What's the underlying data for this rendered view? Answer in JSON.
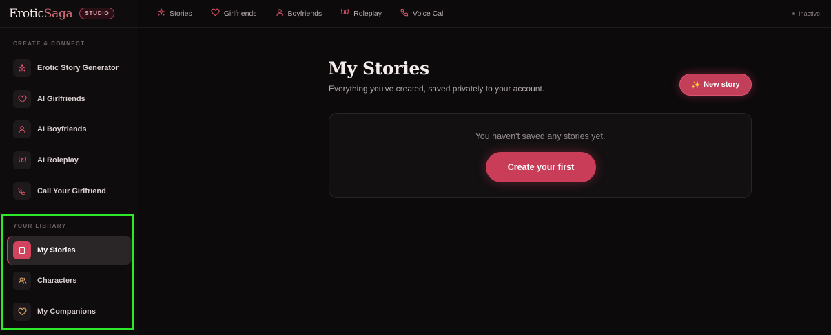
{
  "brand": {
    "name_part1": "Erotic",
    "name_part2": "Saga",
    "badge": "STUDIO"
  },
  "sidebar": {
    "create_section_label": "CREATE & CONNECT",
    "create_items": [
      {
        "label": "Erotic Story Generator",
        "icon": "sparkles-icon"
      },
      {
        "label": "AI Girlfriends",
        "icon": "heart-icon"
      },
      {
        "label": "AI Boyfriends",
        "icon": "user-icon"
      },
      {
        "label": "AI Roleplay",
        "icon": "masks-icon"
      },
      {
        "label": "Call Your Girlfriend",
        "icon": "phone-icon"
      }
    ],
    "library_section_label": "YOUR LIBRARY",
    "library_items": [
      {
        "label": "My Stories",
        "icon": "book-icon",
        "active": true
      },
      {
        "label": "Characters",
        "icon": "users-icon"
      },
      {
        "label": "My Companions",
        "icon": "heart-icon"
      }
    ]
  },
  "topnav": {
    "items": [
      {
        "label": "Stories",
        "icon": "sparkles-icon"
      },
      {
        "label": "Girlfriends",
        "icon": "heart-icon"
      },
      {
        "label": "Boyfriends",
        "icon": "user-icon"
      },
      {
        "label": "Roleplay",
        "icon": "masks-icon"
      },
      {
        "label": "Voice Call",
        "icon": "phone-icon"
      }
    ],
    "status": "Inactive"
  },
  "main": {
    "title": "My Stories",
    "subtitle": "Everything you've created, saved privately to your account.",
    "new_story_label": "New story",
    "empty_text": "You haven't saved any stories yet.",
    "create_first_label": "Create your first"
  },
  "colors": {
    "accent": "#c93d59",
    "background": "#0c0a0b",
    "highlight": "#2ee82a"
  }
}
